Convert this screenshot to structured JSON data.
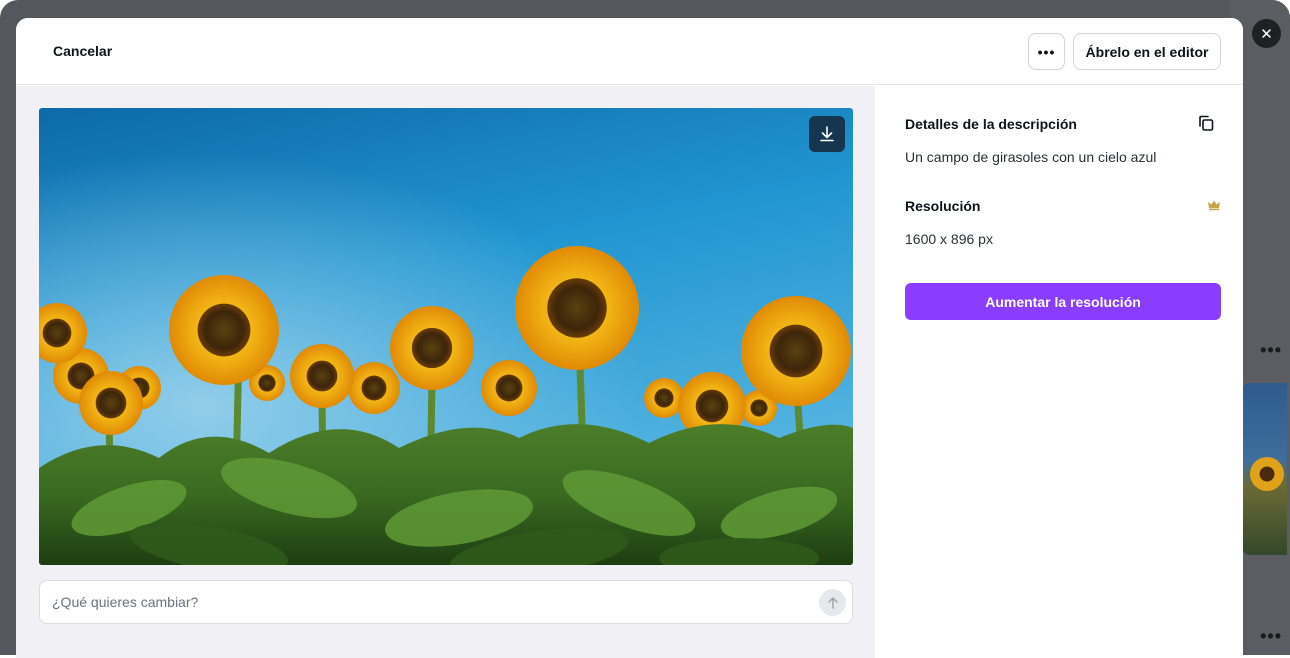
{
  "header": {
    "cancel_label": "Cancelar",
    "more_label": "•••",
    "open_editor_label": "Ábrelo en el editor"
  },
  "close_label": "✕",
  "image": {
    "alt": "Un campo de girasoles con un cielo azul"
  },
  "prompt": {
    "placeholder": "¿Qué quieres cambiar?",
    "value": ""
  },
  "details": {
    "description_title": "Detalles de la descripción",
    "description_value": "Un campo de girasoles con un cielo azul",
    "resolution_title": "Resolución",
    "resolution_value": "1600 x 896 px",
    "upscale_label": "Aumentar la resolución"
  },
  "background": {
    "dots_label": "•••"
  },
  "colors": {
    "accent": "#8b3dff",
    "text": "#0e1318",
    "pane_bg": "#f1f1f5"
  },
  "icons": {
    "copy": "copy-icon",
    "crown": "crown-icon",
    "download": "download-icon",
    "send": "arrow-up-icon",
    "close": "close-icon"
  }
}
